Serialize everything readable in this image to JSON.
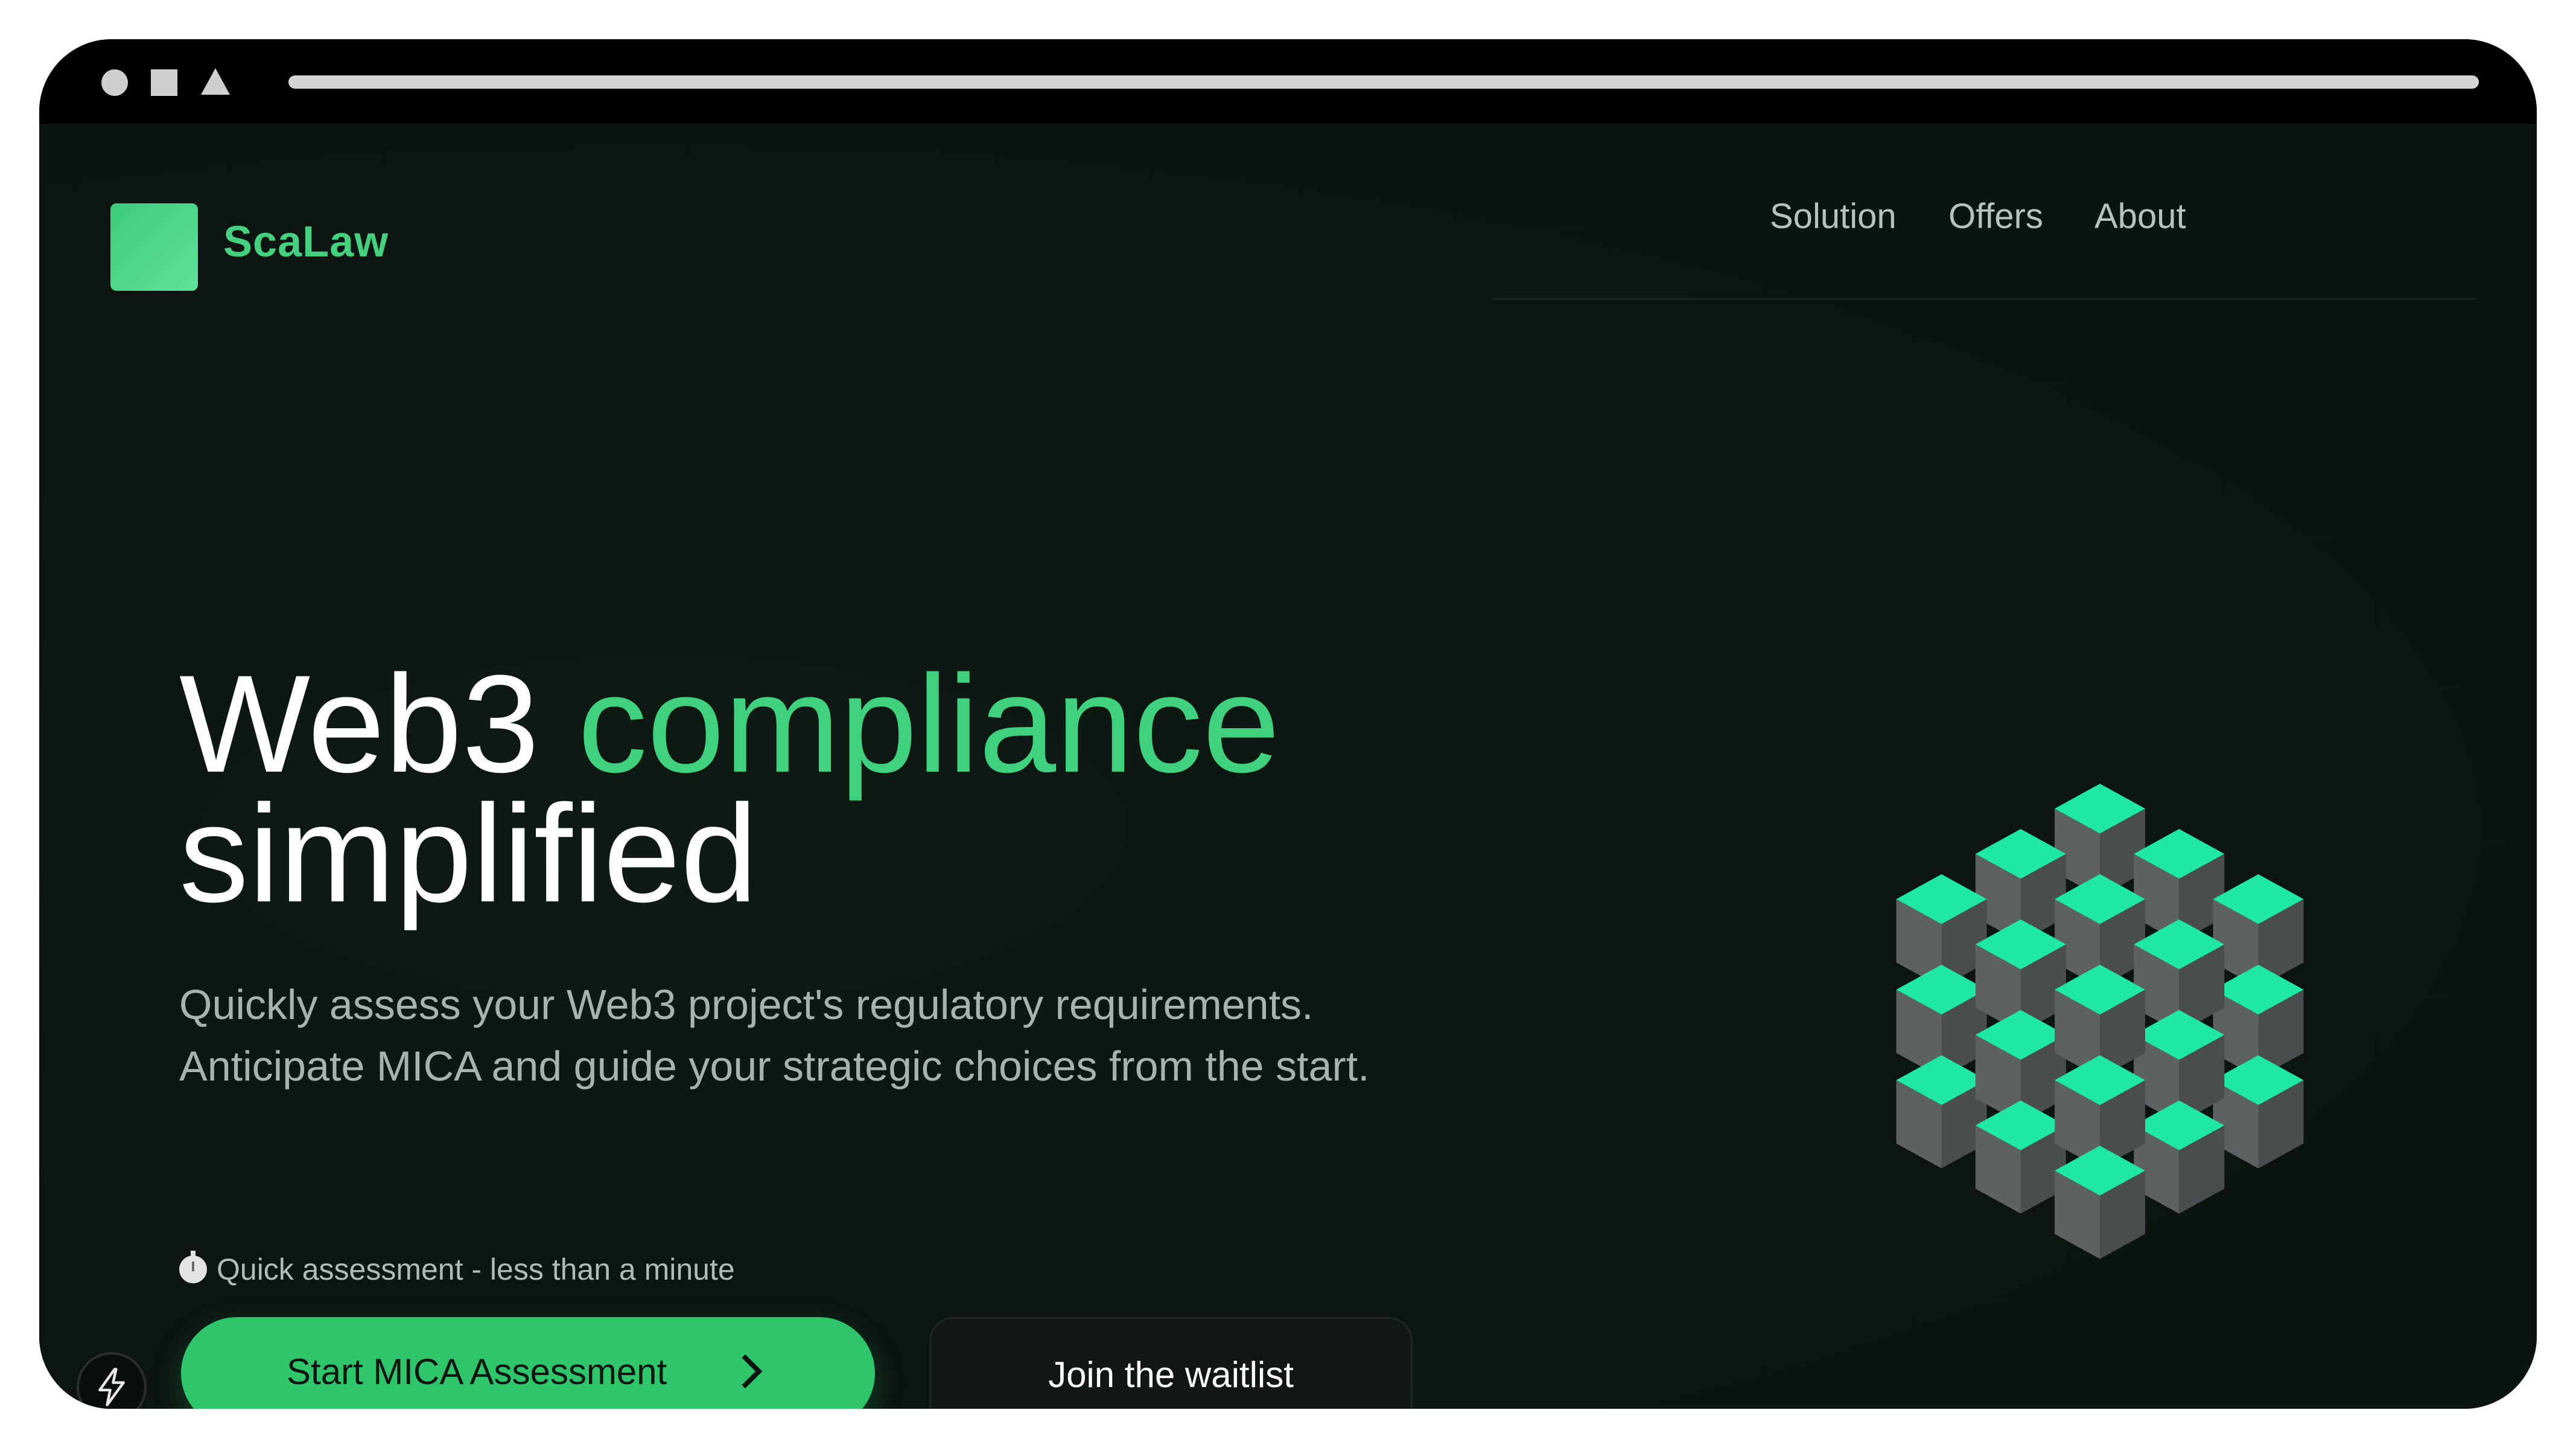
{
  "brand": {
    "name": "ScaLaw",
    "accent": "#40d17e"
  },
  "nav": {
    "items": [
      "Solution",
      "Offers",
      "About"
    ]
  },
  "hero": {
    "title_part1": "Web3",
    "title_highlight": "compliance",
    "title_line2": "simplified",
    "subtitle_line1": "Quickly assess your Web3 project's regulatory requirements.",
    "subtitle_line2": "Anticipate MICA and guide your strategic choices from the start.",
    "quick_note": "Quick assessment - less than a minute",
    "quick_icon": "stopwatch-icon"
  },
  "cta": {
    "primary_label": "Start MICA Assessment",
    "primary_icon": "chevron-right-icon",
    "secondary_label": "Join the waitlist"
  },
  "floating": {
    "icon": "lightning-icon"
  },
  "illustration": {
    "icon": "cube-cluster-illustration",
    "top_color": "#1ee8a4",
    "side_color": "#5d6161"
  }
}
